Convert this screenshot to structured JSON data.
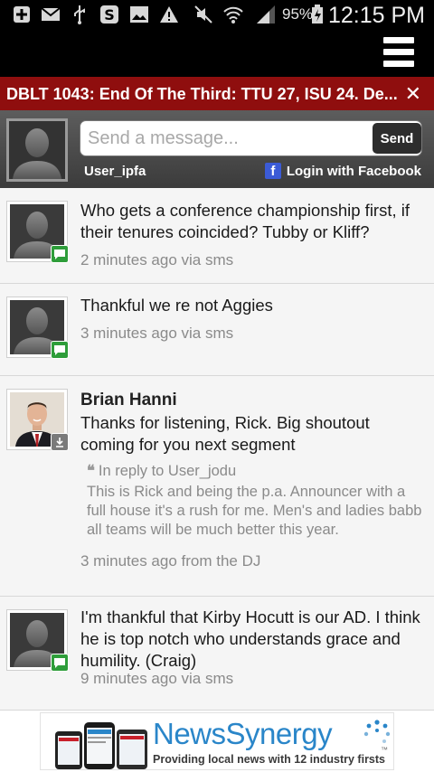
{
  "status_bar": {
    "battery": "95%",
    "time": "12:15 PM"
  },
  "ticker": {
    "text": "DBLT 1043: End Of The Third: TTU 27, ISU 24.  De...",
    "close": "✕"
  },
  "composer": {
    "placeholder": "Send a message...",
    "send_label": "Send",
    "user_name": "User_ipfa",
    "fb_icon": "f",
    "fb_login": "Login with Facebook"
  },
  "feed": {
    "posts": [
      {
        "body": "Who gets a conference championship first, if their tenures coincided? Tubby or Kliff?",
        "meta": "2 minutes ago via sms"
      },
      {
        "body": "Thankful we re not Aggies",
        "meta": "3 minutes ago via sms"
      },
      {
        "author": "Brian Hanni",
        "body": "Thanks for listening, Rick. Big shoutout coming for you next segment",
        "reply_head": "In reply to User_jodu",
        "reply_body": "This is Rick and being the p.a. Announcer with a full house it's a rush for me. Men's and ladies babb all teams will be much better this year.",
        "meta": "3 minutes ago from the DJ"
      },
      {
        "body": "I'm thankful that Kirby Hocutt is our AD. I think he is top notch who understands grace and humility. (Craig)",
        "meta": "9 minutes ago via sms"
      }
    ]
  },
  "ad": {
    "title": "NewsSynergy",
    "trademark": "™",
    "tagline": "Providing local news with 12 industry firsts"
  },
  "colors": {
    "ticker_bg": "#8f0e0e",
    "sms_badge": "#2e9d3a",
    "facebook_blue": "#3b5bd6",
    "ad_blue": "#2a86c9"
  },
  "icons": [
    "plus-icon",
    "mail-icon",
    "usb-icon",
    "s-app-icon",
    "image-icon",
    "warning-icon",
    "mute-icon",
    "wifi-icon",
    "signal-icon",
    "battery-icon",
    "menu-icon",
    "close-icon",
    "facebook-icon",
    "sms-icon",
    "download-icon",
    "quote-icon"
  ]
}
